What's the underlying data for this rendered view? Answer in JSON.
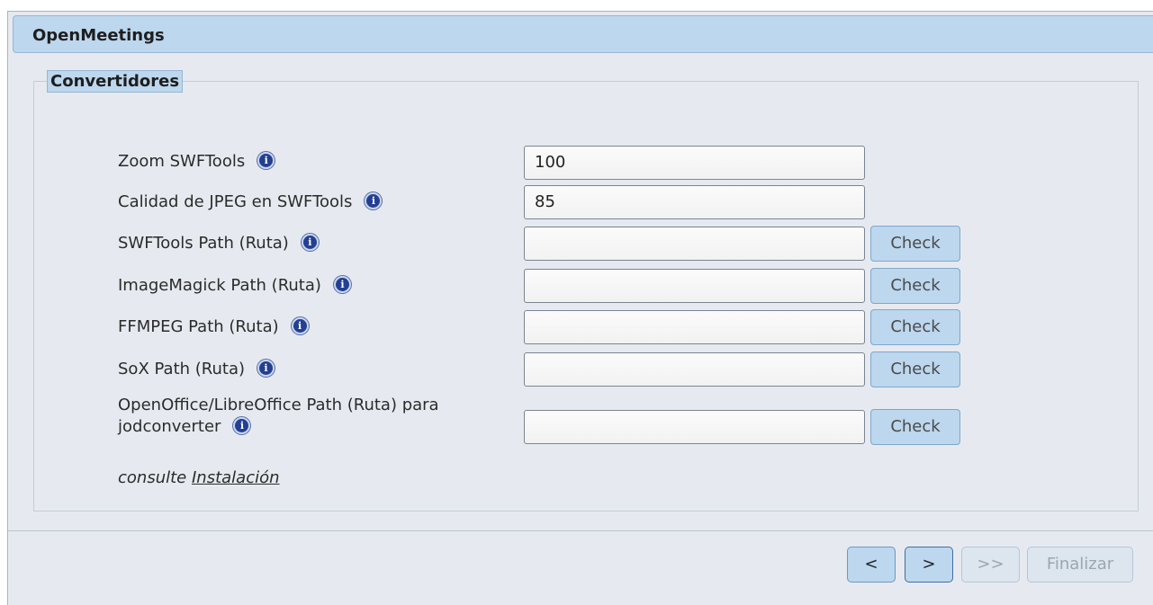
{
  "window": {
    "title": "OpenMeetings"
  },
  "section": {
    "legend": "Convertidores"
  },
  "fields": [
    {
      "label": "Zoom SWFTools",
      "value": "100",
      "has_check": false,
      "info_icon": "info-icon"
    },
    {
      "label": "Calidad de JPEG en SWFTools",
      "value": "85",
      "has_check": false,
      "info_icon": "info-icon"
    },
    {
      "label": "SWFTools Path (Ruta)",
      "value": "",
      "has_check": true,
      "info_icon": "info-icon"
    },
    {
      "label": "ImageMagick Path (Ruta)",
      "value": "",
      "has_check": true,
      "info_icon": "info-icon"
    },
    {
      "label": "FFMPEG Path (Ruta)",
      "value": "",
      "has_check": true,
      "info_icon": "info-icon"
    },
    {
      "label": "SoX Path (Ruta)",
      "value": "",
      "has_check": true,
      "info_icon": "info-icon"
    },
    {
      "label_line1": "OpenOffice/LibreOffice Path (Ruta) para",
      "label_line2": "jodconverter",
      "value": "",
      "has_check": true,
      "info_icon": "info-icon"
    }
  ],
  "check_label": "Check",
  "note": {
    "prefix": "consulte",
    "link": "Instalación"
  },
  "nav": {
    "prev": "<",
    "next": ">",
    "last": ">>",
    "finish": "Finalizar"
  },
  "colors": {
    "accent": "#bcd7ee",
    "panel": "#e6eaf0",
    "info_icon": "#233f93"
  }
}
